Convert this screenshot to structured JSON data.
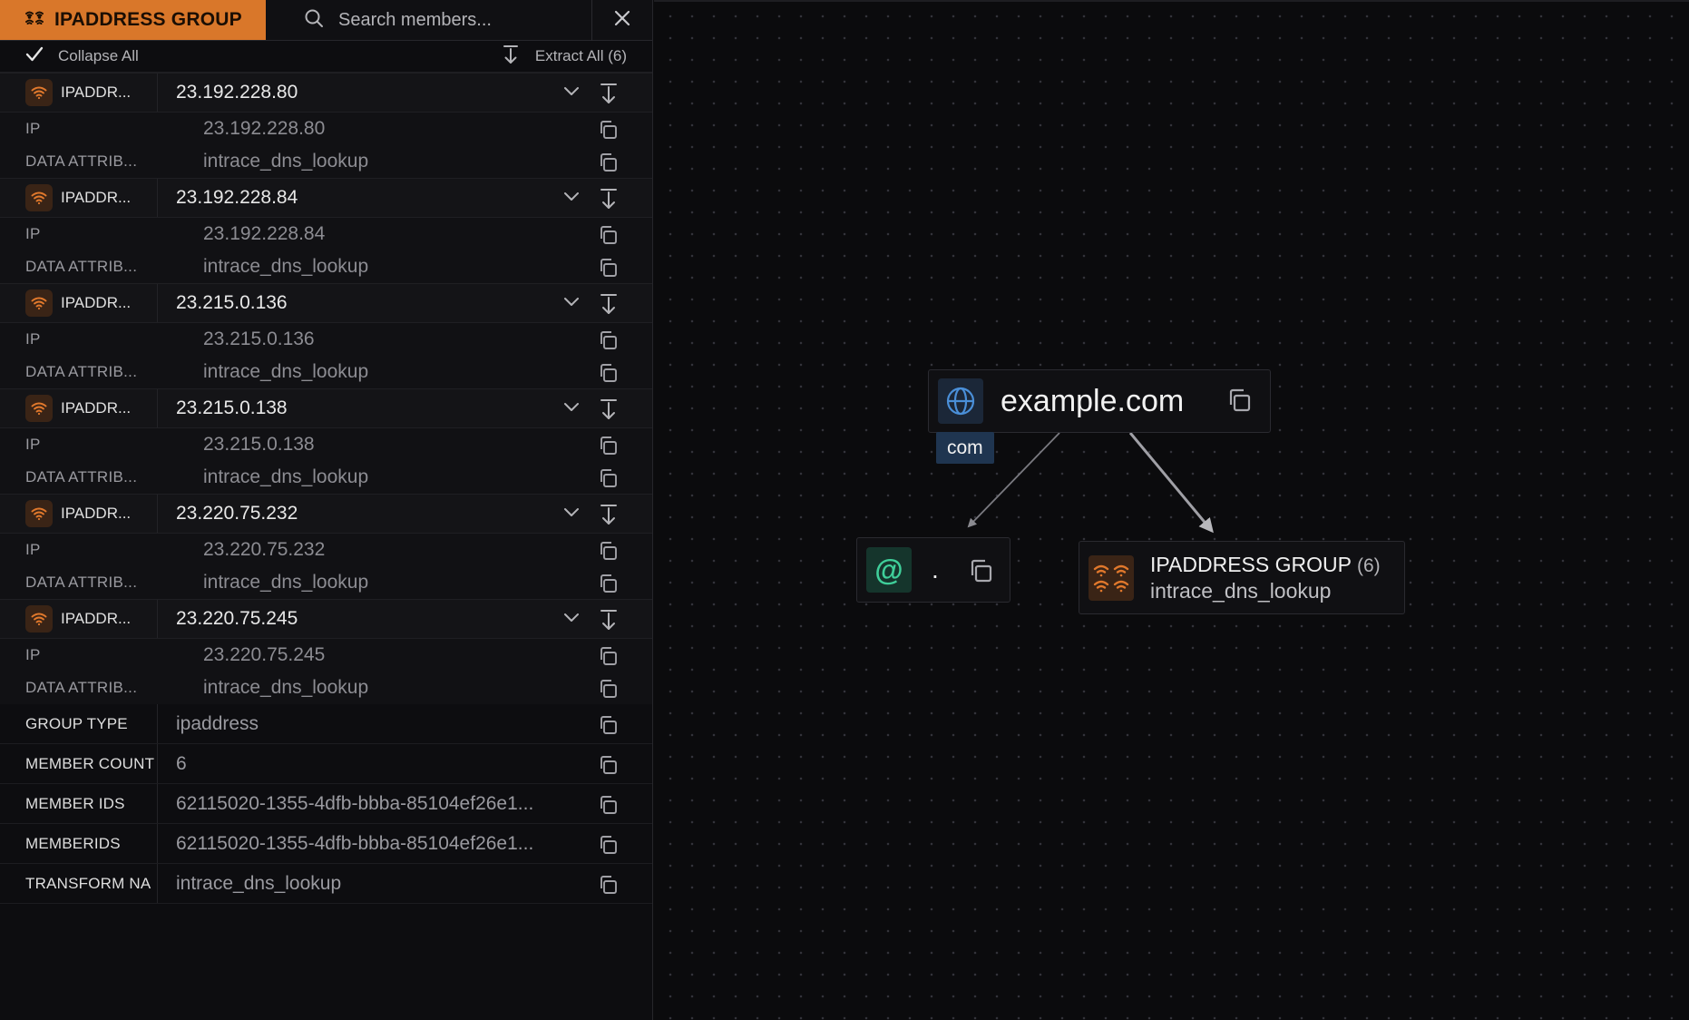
{
  "panel": {
    "title": "IPADDRESS GROUP",
    "search_placeholder": "Search members...",
    "collapse_all": "Collapse All",
    "extract_all": "Extract All (6)"
  },
  "members": [
    {
      "short": "IPADDR...",
      "value": "23.192.228.80",
      "ip_key": "IP",
      "ip": "23.192.228.80",
      "attr_key": "DATA ATTRIB...",
      "attr": "intrace_dns_lookup"
    },
    {
      "short": "IPADDR...",
      "value": "23.192.228.84",
      "ip_key": "IP",
      "ip": "23.192.228.84",
      "attr_key": "DATA ATTRIB...",
      "attr": "intrace_dns_lookup"
    },
    {
      "short": "IPADDR...",
      "value": "23.215.0.136",
      "ip_key": "IP",
      "ip": "23.215.0.136",
      "attr_key": "DATA ATTRIB...",
      "attr": "intrace_dns_lookup"
    },
    {
      "short": "IPADDR...",
      "value": "23.215.0.138",
      "ip_key": "IP",
      "ip": "23.215.0.138",
      "attr_key": "DATA ATTRIB...",
      "attr": "intrace_dns_lookup"
    },
    {
      "short": "IPADDR...",
      "value": "23.220.75.232",
      "ip_key": "IP",
      "ip": "23.220.75.232",
      "attr_key": "DATA ATTRIB...",
      "attr": "intrace_dns_lookup"
    },
    {
      "short": "IPADDR...",
      "value": "23.220.75.245",
      "ip_key": "IP",
      "ip": "23.220.75.245",
      "attr_key": "DATA ATTRIB...",
      "attr": "intrace_dns_lookup"
    }
  ],
  "properties": [
    {
      "key": "GROUP TYPE",
      "value": "ipaddress"
    },
    {
      "key": "MEMBER COUNT",
      "value": "6"
    },
    {
      "key": "MEMBER IDS",
      "value": "62115020-1355-4dfb-bbba-85104ef26e1..."
    },
    {
      "key": "MEMBERIDS",
      "value": "62115020-1355-4dfb-bbba-85104ef26e1..."
    },
    {
      "key": "TRANSFORM NA",
      "value": "intrace_dns_lookup"
    }
  ],
  "graph": {
    "domain": "example.com",
    "tld": "com",
    "email": ".",
    "group_title": "IPADDRESS GROUP",
    "group_count": "(6)",
    "group_sub": "intrace_dns_lookup"
  },
  "colors": {
    "accent": "#d9772a",
    "globe": "#4a8fd8",
    "email": "#3fcf9a"
  },
  "icons": {
    "title": "wifi-group-icon",
    "search": "search-icon",
    "close": "close-icon",
    "collapse": "checkmark-icon",
    "extract": "download-arrow-icon",
    "member": "wifi-icon",
    "chevron": "chevron-down-icon",
    "copy": "copy-icon",
    "domain": "globe-icon",
    "email": "at-sign-icon"
  }
}
